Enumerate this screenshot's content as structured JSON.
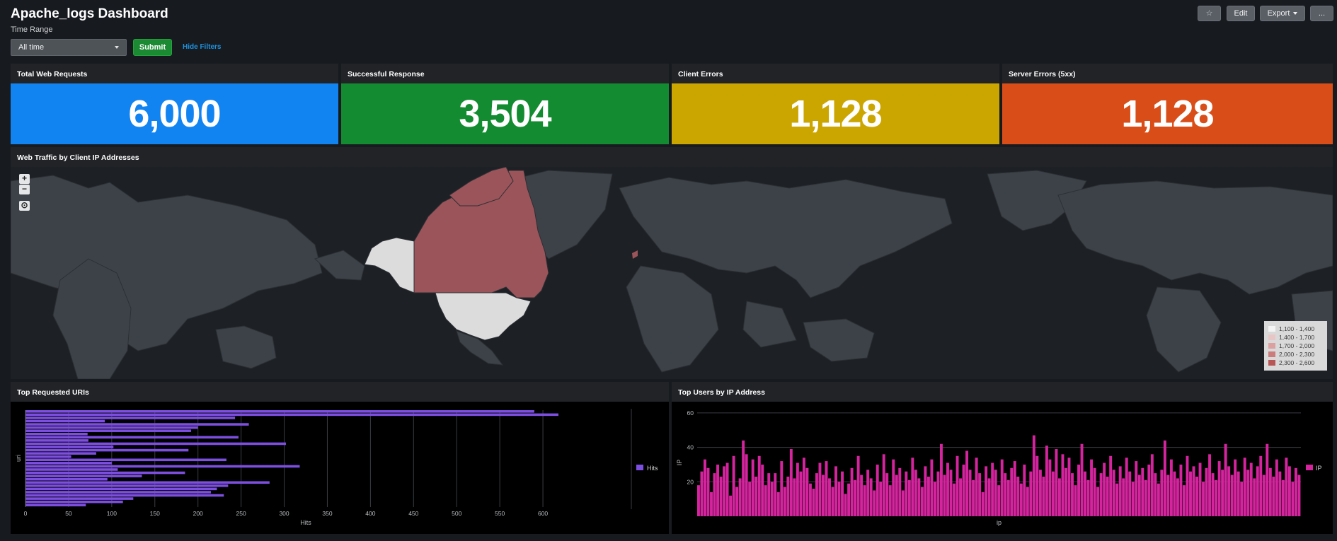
{
  "dashboard": {
    "title": "Apache_logs Dashboard",
    "time_range_label": "Time Range",
    "time_range_value": "All time",
    "submit_label": "Submit",
    "hide_filters_label": "Hide Filters",
    "buttons": {
      "star": "☆",
      "edit": "Edit",
      "export": "Export",
      "more": "..."
    }
  },
  "kpis": [
    {
      "title": "Total Web Requests",
      "value": "6,000",
      "color": "#1184f2"
    },
    {
      "title": "Successful Response",
      "value": "3,504",
      "color": "#138b30"
    },
    {
      "title": "Client Errors",
      "value": "1,128",
      "color": "#cca600"
    },
    {
      "title": "Server Errors (5xx)",
      "value": "1,128",
      "color": "#d94e18"
    }
  ],
  "map": {
    "title": "Web Traffic by Client IP Addresses",
    "controls": {
      "zoom_in": "+",
      "zoom_out": "−",
      "reset": "⊙"
    },
    "legend": [
      {
        "label": "1,100 - 1,400",
        "color": "#f4f4f4"
      },
      {
        "label": "1,400 - 1,700",
        "color": "#e8c6c6"
      },
      {
        "label": "1,700 - 2,000",
        "color": "#dda0a0"
      },
      {
        "label": "2,000 - 2,300",
        "color": "#cd7c7c"
      },
      {
        "label": "2,300 - 2,600",
        "color": "#b85656"
      }
    ]
  },
  "chart_data": [
    {
      "type": "bar",
      "orientation": "horizontal",
      "title": "Top Requested URIs",
      "xlabel": "Hits",
      "ylabel": "uri",
      "xlim": [
        0,
        650
      ],
      "xticks": [
        0,
        50,
        100,
        150,
        200,
        250,
        300,
        350,
        400,
        450,
        500,
        550,
        600
      ],
      "series": [
        {
          "name": "Hits",
          "color": "#7c4fe0",
          "values": [
            590,
            618,
            243,
            92,
            259,
            200,
            192,
            72,
            247,
            73,
            302,
            102,
            189,
            82,
            53,
            233,
            100,
            318,
            107,
            185,
            135,
            95,
            283,
            235,
            222,
            215,
            230,
            125,
            113,
            70
          ]
        }
      ],
      "legend": "right"
    },
    {
      "type": "bar",
      "title": "Top Users by IP Address",
      "xlabel": "ip",
      "ylabel": "IP",
      "ylim": [
        0,
        62
      ],
      "yticks": [
        20,
        40,
        60
      ],
      "series": [
        {
          "name": "IP",
          "color": "#d6249f",
          "values": [
            18,
            26,
            33,
            28,
            14,
            25,
            30,
            23,
            29,
            31,
            12,
            35,
            17,
            22,
            44,
            36,
            20,
            33,
            23,
            35,
            30,
            18,
            25,
            20,
            25,
            14,
            32,
            17,
            23,
            39,
            22,
            31,
            26,
            34,
            28,
            19,
            16,
            25,
            31,
            24,
            32,
            22,
            17,
            29,
            20,
            26,
            13,
            19,
            28,
            21,
            35,
            24,
            18,
            27,
            22,
            15,
            30,
            20,
            36,
            25,
            18,
            33,
            24,
            28,
            15,
            26,
            21,
            34,
            27,
            22,
            17,
            29,
            23,
            33,
            20,
            26,
            42,
            24,
            31,
            27,
            19,
            35,
            22,
            30,
            38,
            27,
            21,
            34,
            25,
            14,
            29,
            22,
            31,
            27,
            18,
            33,
            25,
            21,
            28,
            32,
            23,
            19,
            30,
            17,
            26,
            47,
            35,
            27,
            23,
            41,
            33,
            26,
            39,
            22,
            36,
            28,
            34,
            25,
            18,
            30,
            42,
            26,
            21,
            33,
            28,
            17,
            25,
            31,
            23,
            35,
            27,
            19,
            29,
            22,
            34,
            26,
            20,
            32,
            24,
            28,
            21,
            30,
            36,
            25,
            19,
            27,
            44,
            24,
            33,
            26,
            22,
            30,
            18,
            35,
            26,
            29,
            23,
            31,
            20,
            28,
            36,
            25,
            21,
            32,
            27,
            42,
            29,
            24,
            33,
            26,
            20,
            34,
            27,
            31,
            22,
            29,
            35,
            24,
            42,
            28,
            23,
            33,
            26,
            21,
            34,
            29,
            20,
            28,
            24
          ]
        }
      ],
      "legend": "right"
    }
  ]
}
